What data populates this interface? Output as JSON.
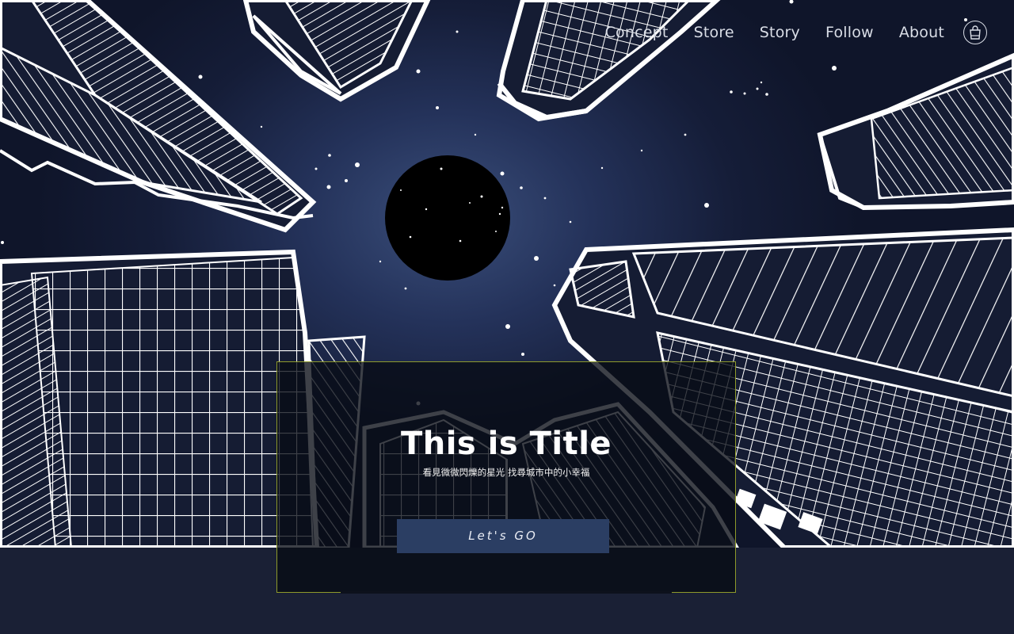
{
  "nav": {
    "links": [
      "Concept",
      "Store",
      "Story",
      "Follow",
      "About"
    ],
    "cart_icon": "shopping-bag-icon"
  },
  "hero": {
    "title": "This is Title",
    "subtitle": "看見微微閃爍的星光 找尋城市中的小幸福",
    "cta_label": "Let's GO"
  },
  "colors": {
    "sky_center": "#3a4e7a",
    "sky_edge": "#0f152a",
    "panel_border": "#8e9a2b",
    "button": "#2b3e63",
    "footer_band": "#1a2035"
  }
}
